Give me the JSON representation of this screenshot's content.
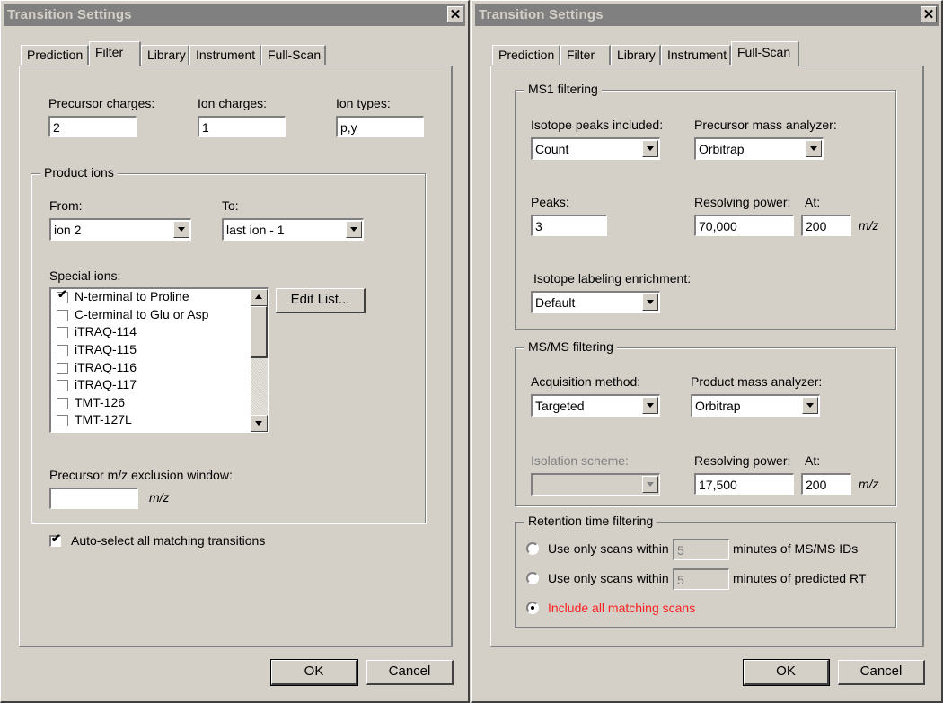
{
  "left_dialog": {
    "title": "Transition Settings",
    "tabs": [
      {
        "label": "Prediction",
        "active": false
      },
      {
        "label": "Filter",
        "active": true
      },
      {
        "label": "Library",
        "active": false
      },
      {
        "label": "Instrument",
        "active": false
      },
      {
        "label": "Full-Scan",
        "active": false
      }
    ],
    "precursor_charges": {
      "label": "Precursor charges:",
      "value": "2"
    },
    "ion_charges": {
      "label": "Ion charges:",
      "value": "1"
    },
    "ion_types": {
      "label": "Ion types:",
      "value": "p,y"
    },
    "product_ions": {
      "title": "Product ions",
      "from": {
        "label": "From:",
        "value": "ion 2"
      },
      "to": {
        "label": "To:",
        "value": "last ion - 1"
      },
      "special_ions": {
        "label": "Special ions:",
        "items": [
          {
            "label": "N-terminal to Proline",
            "checked": true
          },
          {
            "label": "C-terminal to Glu or Asp",
            "checked": false
          },
          {
            "label": "iTRAQ-114",
            "checked": false
          },
          {
            "label": "iTRAQ-115",
            "checked": false
          },
          {
            "label": "iTRAQ-116",
            "checked": false
          },
          {
            "label": "iTRAQ-117",
            "checked": false
          },
          {
            "label": "TMT-126",
            "checked": false
          },
          {
            "label": "TMT-127L",
            "checked": false
          }
        ]
      },
      "edit_list_label": "Edit List...",
      "exclusion_window": {
        "label": "Precursor m/z exclusion window:",
        "value": "",
        "unit": "m/z"
      }
    },
    "auto_select": {
      "label": "Auto-select all matching transitions",
      "checked": true
    },
    "ok_label": "OK",
    "cancel_label": "Cancel"
  },
  "right_dialog": {
    "title": "Transition Settings",
    "tabs": [
      {
        "label": "Prediction",
        "active": false
      },
      {
        "label": "Filter",
        "active": false
      },
      {
        "label": "Library",
        "active": false
      },
      {
        "label": "Instrument",
        "active": false
      },
      {
        "label": "Full-Scan",
        "active": true
      }
    ],
    "ms1": {
      "title": "MS1 filtering",
      "isotope_peaks": {
        "label": "Isotope peaks included:",
        "value": "Count"
      },
      "precursor_analyzer": {
        "label": "Precursor mass analyzer:",
        "value": "Orbitrap"
      },
      "peaks": {
        "label": "Peaks:",
        "value": "3"
      },
      "resolving_power": {
        "label": "Resolving power:",
        "value": "70,000"
      },
      "at": {
        "label": "At:",
        "value": "200",
        "unit": "m/z"
      },
      "enrichment": {
        "label": "Isotope labeling enrichment:",
        "value": "Default"
      }
    },
    "msms": {
      "title": "MS/MS filtering",
      "acquisition": {
        "label": "Acquisition method:",
        "value": "Targeted"
      },
      "product_analyzer": {
        "label": "Product mass analyzer:",
        "value": "Orbitrap"
      },
      "isolation": {
        "label": "Isolation scheme:",
        "value": ""
      },
      "resolving_power": {
        "label": "Resolving power:",
        "value": "17,500"
      },
      "at": {
        "label": "At:",
        "value": "200",
        "unit": "m/z"
      }
    },
    "rt": {
      "title": "Retention time filtering",
      "options": [
        {
          "prefix": "Use only scans within",
          "value": "5",
          "suffix": "minutes of MS/MS IDs",
          "selected": false
        },
        {
          "prefix": "Use only scans within",
          "value": "5",
          "suffix": "minutes of predicted RT",
          "selected": false
        },
        {
          "prefix": "Include all matching scans",
          "selected": true
        }
      ],
      "highlight_color": "#ff2020"
    },
    "ok_label": "OK",
    "cancel_label": "Cancel"
  }
}
